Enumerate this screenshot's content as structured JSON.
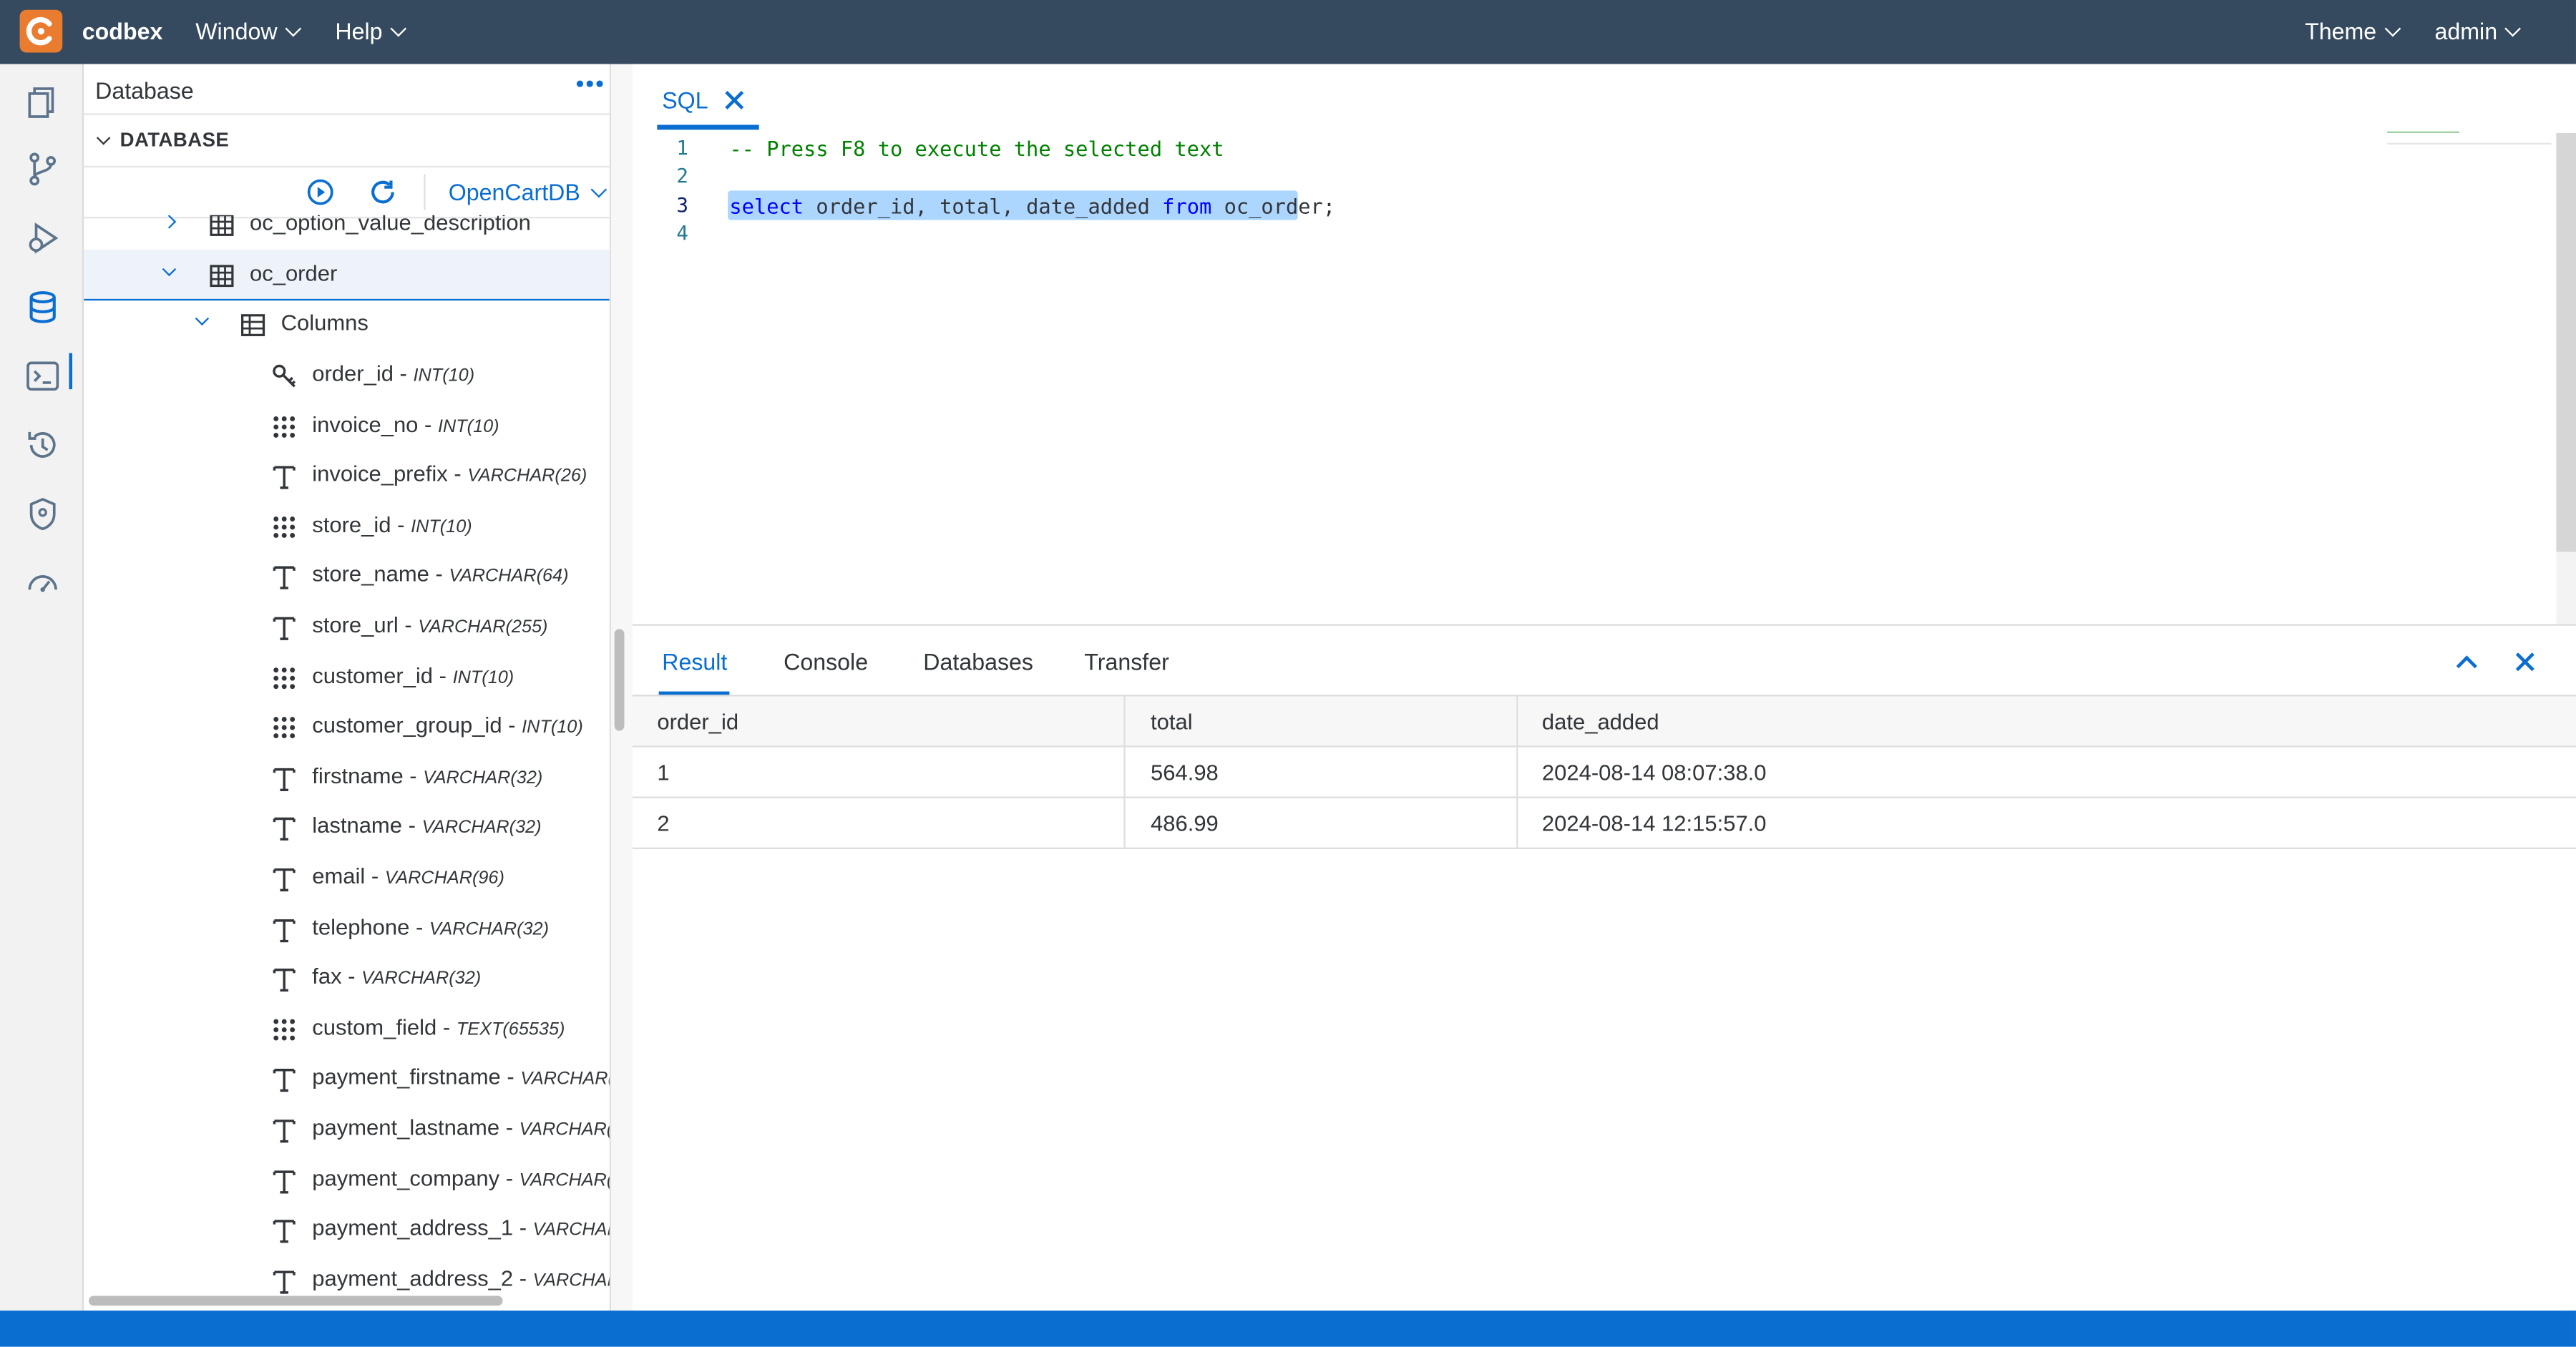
{
  "app": {
    "name": "codbex"
  },
  "menu": {
    "window": "Window",
    "help": "Help",
    "theme": "Theme",
    "user": "admin"
  },
  "db_panel": {
    "title": "Database",
    "section": "DATABASE",
    "datasource": "OpenCartDB",
    "tree": {
      "table_prev": "oc_option_value_description",
      "table_selected": "oc_order",
      "folder": "Columns",
      "columns": [
        {
          "name": "order_id -",
          "type": "INT(10)",
          "icon": "key-icon"
        },
        {
          "name": "invoice_no -",
          "type": "INT(10)",
          "icon": "numeric-icon"
        },
        {
          "name": "invoice_prefix -",
          "type": "VARCHAR(26)",
          "icon": "text-icon"
        },
        {
          "name": "store_id -",
          "type": "INT(10)",
          "icon": "numeric-icon"
        },
        {
          "name": "store_name -",
          "type": "VARCHAR(64)",
          "icon": "text-icon"
        },
        {
          "name": "store_url -",
          "type": "VARCHAR(255)",
          "icon": "text-icon"
        },
        {
          "name": "customer_id -",
          "type": "INT(10)",
          "icon": "numeric-icon"
        },
        {
          "name": "customer_group_id -",
          "type": "INT(10)",
          "icon": "numeric-icon"
        },
        {
          "name": "firstname -",
          "type": "VARCHAR(32)",
          "icon": "text-icon"
        },
        {
          "name": "lastname -",
          "type": "VARCHAR(32)",
          "icon": "text-icon"
        },
        {
          "name": "email -",
          "type": "VARCHAR(96)",
          "icon": "text-icon"
        },
        {
          "name": "telephone -",
          "type": "VARCHAR(32)",
          "icon": "text-icon"
        },
        {
          "name": "fax -",
          "type": "VARCHAR(32)",
          "icon": "text-icon"
        },
        {
          "name": "custom_field -",
          "type": "TEXT(65535)",
          "icon": "numeric-icon"
        },
        {
          "name": "payment_firstname -",
          "type": "VARCHAR(",
          "icon": "text-icon"
        },
        {
          "name": "payment_lastname -",
          "type": "VARCHAR(",
          "icon": "text-icon"
        },
        {
          "name": "payment_company -",
          "type": "VARCHAR(",
          "icon": "text-icon"
        },
        {
          "name": "payment_address_1 -",
          "type": "VARCHAR",
          "icon": "text-icon"
        },
        {
          "name": "payment_address_2 -",
          "type": "VARCHAR",
          "icon": "text-icon"
        }
      ]
    }
  },
  "editor": {
    "tab": "SQL",
    "line_numbers": [
      "1",
      "2",
      "3",
      "4"
    ],
    "comment": "-- Press F8 to execute the selected text",
    "kw_select": "select",
    "columns": "order_id, total, date_added",
    "kw_from": "from",
    "table": "oc_order;"
  },
  "result": {
    "tabs": [
      "Result",
      "Console",
      "Databases",
      "Transfer"
    ],
    "headers": [
      "order_id",
      "total",
      "date_added"
    ],
    "rows": [
      [
        "1",
        "564.98",
        "2024-08-14 08:07:38.0"
      ],
      [
        "2",
        "486.99",
        "2024-08-14 12:15:57.0"
      ]
    ]
  },
  "colors": {
    "topbar": "#354a5f",
    "accent": "#0a6ed1",
    "logo": "#e97c2f"
  }
}
